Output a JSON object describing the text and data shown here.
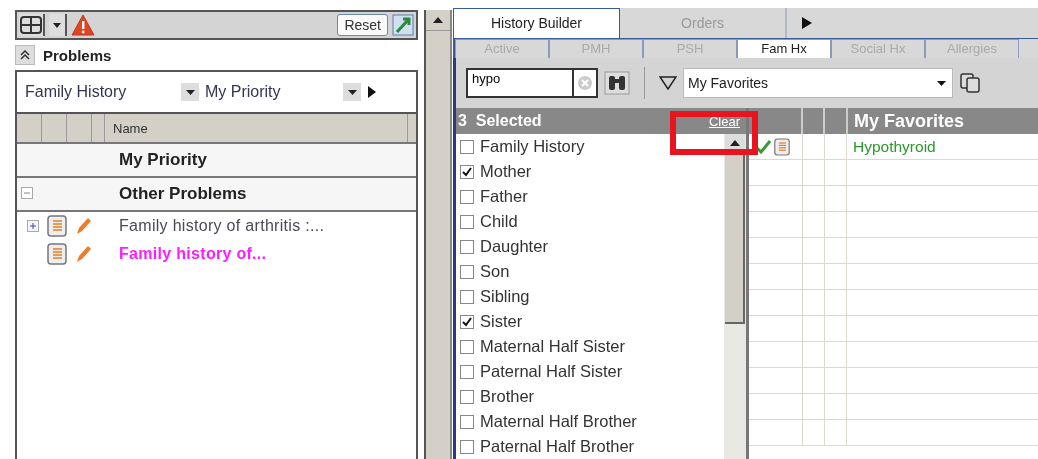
{
  "toolbar": {
    "reset_button": "Reset"
  },
  "problems": {
    "title": "Problems",
    "filter_1": "Family History",
    "filter_2": "My Priority",
    "column_name": "Name",
    "groups": [
      {
        "label": "My Priority",
        "kind": "plain"
      },
      {
        "label": "Other Problems",
        "kind": "collapsible",
        "expanded": true
      }
    ],
    "rows": [
      {
        "text": "Family history of arthritis :...",
        "kind": "parent",
        "expanded": false,
        "color": "#4a4a55"
      },
      {
        "text": "Family history of...",
        "kind": "leaf",
        "color": "#ff1aff"
      }
    ]
  },
  "history": {
    "tabs": [
      {
        "label": "History Builder",
        "selected": true
      },
      {
        "label": "Orders",
        "selected": false
      }
    ],
    "subtabs": [
      {
        "label": "Active",
        "selected": false
      },
      {
        "label": "PMH",
        "selected": false
      },
      {
        "label": "PSH",
        "selected": false
      },
      {
        "label": "Fam Hx",
        "selected": true
      },
      {
        "label": "Social Hx",
        "selected": false
      },
      {
        "label": "Allergies",
        "selected": false
      }
    ],
    "search": {
      "value": "hypo"
    },
    "filter": "My Favorites",
    "selected_count": "3",
    "selected_label": "Selected",
    "clear_link": "Clear",
    "relatives": [
      {
        "label": "Family History",
        "checked": false
      },
      {
        "label": "Mother",
        "checked": true
      },
      {
        "label": "Father",
        "checked": false
      },
      {
        "label": "Child",
        "checked": false
      },
      {
        "label": "Daughter",
        "checked": false
      },
      {
        "label": "Son",
        "checked": false
      },
      {
        "label": "Sibling",
        "checked": false
      },
      {
        "label": "Sister",
        "checked": true
      },
      {
        "label": "Maternal Half Sister",
        "checked": false
      },
      {
        "label": "Paternal Half Sister",
        "checked": false
      },
      {
        "label": "Brother",
        "checked": false
      },
      {
        "label": "Maternal Half Brother",
        "checked": false
      },
      {
        "label": "Paternal Half Brother",
        "checked": false
      }
    ],
    "favorites_title": "My Favorites",
    "favorites": [
      {
        "text": "Hypothyroid",
        "checked": true
      }
    ]
  }
}
